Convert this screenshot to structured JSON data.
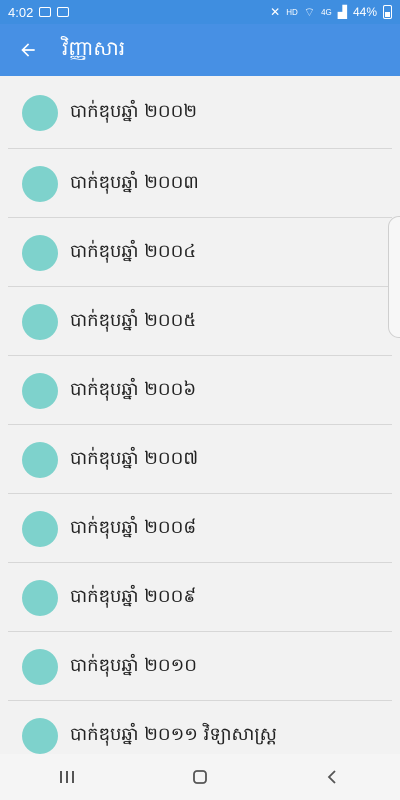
{
  "status_bar": {
    "time": "4:02",
    "signal_label": "HD",
    "network_label": "4G",
    "battery_percent": "44%"
  },
  "app_bar": {
    "title": "វិញ្ញាសារ",
    "back_icon": "arrow-left-icon"
  },
  "list": {
    "items": [
      {
        "label": "បាក់ឌុបឆ្នាំ ២០០២",
        "icon": "book-reading-icon"
      },
      {
        "label": "បាក់ឌុបឆ្នាំ ២០០៣",
        "icon": "book-reading-icon"
      },
      {
        "label": "បាក់ឌុបឆ្នាំ ២០០៤",
        "icon": "book-reading-icon"
      },
      {
        "label": "បាក់ឌុបឆ្នាំ ២០០៥",
        "icon": "book-reading-icon"
      },
      {
        "label": "បាក់ឌុបឆ្នាំ ២០០៦",
        "icon": "book-reading-icon"
      },
      {
        "label": "បាក់ឌុបឆ្នាំ ២០០៧",
        "icon": "book-reading-icon"
      },
      {
        "label": "បាក់ឌុបឆ្នាំ ២០០៨",
        "icon": "book-reading-icon"
      },
      {
        "label": "បាក់ឌុបឆ្នាំ ២០០៩",
        "icon": "book-reading-icon"
      },
      {
        "label": "បាក់ឌុបឆ្នាំ ២០១០",
        "icon": "book-reading-icon"
      },
      {
        "label": "បាក់ឌុបឆ្នាំ ២០១១ វិទ្យាសាស្ត្រ",
        "icon": "book-reading-icon"
      }
    ]
  },
  "colors": {
    "primary": "#4790e4",
    "icon_circle": "#7ed2cc"
  },
  "nav_bar": {
    "recent_icon": "recent-apps-icon",
    "home_icon": "home-icon",
    "back_icon": "back-chevron-icon"
  }
}
